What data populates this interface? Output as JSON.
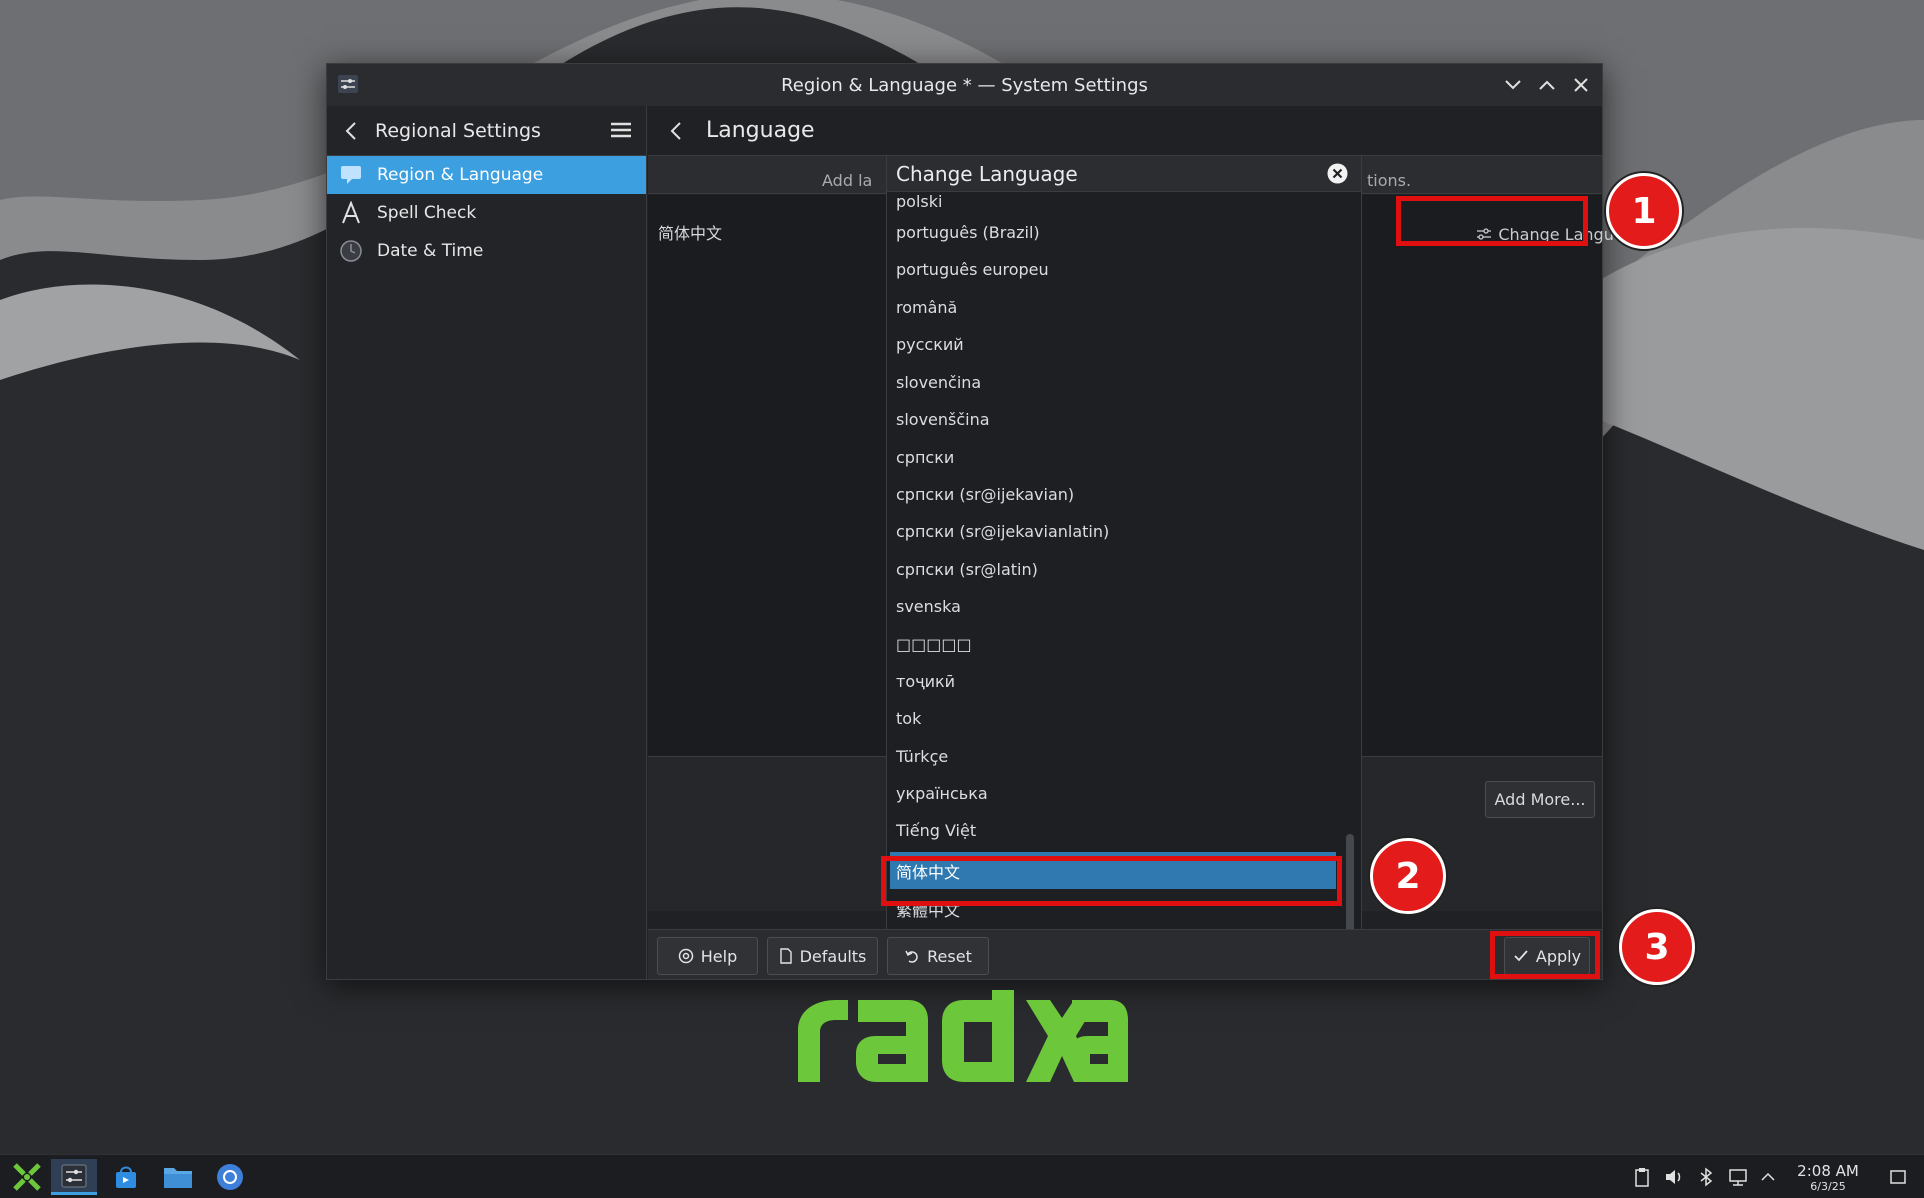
{
  "window": {
    "title": "Region & Language * — System Settings"
  },
  "sidebar": {
    "header": "Regional Settings",
    "items": [
      {
        "label": "Region & Language",
        "icon": "region-language-icon",
        "active": true
      },
      {
        "label": "Spell Check",
        "icon": "spell-check-icon",
        "active": false
      },
      {
        "label": "Date & Time",
        "icon": "clock-icon",
        "active": false
      }
    ]
  },
  "main": {
    "header": "Language",
    "info_left": "Add la",
    "info_right": "tions.",
    "current_language": "简体中文",
    "change_language_label": "Change Language",
    "add_more_label": "Add More..."
  },
  "footer": {
    "help_label": "Help",
    "defaults_label": "Defaults",
    "reset_label": "Reset",
    "apply_label": "Apply"
  },
  "popup": {
    "title": "Change Language",
    "options": [
      "polski",
      "português (Brazil)",
      "português europeu",
      "română",
      "русский",
      "slovenčina",
      "slovenščina",
      "српски",
      "српски (sr@ijekavian)",
      "српски (sr@ijekavianlatin)",
      "српски (sr@latin)",
      "svenska",
      "□□□□□",
      "тоҷикӣ",
      "tok",
      "Türkçe",
      "українська",
      "Tiếng Việt",
      "简体中文",
      "繁體中文"
    ],
    "selected": "简体中文"
  },
  "annotations": {
    "badge_1": "1",
    "badge_2": "2",
    "badge_3": "3",
    "color": "#e01010"
  },
  "taskbar": {
    "time": "2:08 AM",
    "date": "6/3/25"
  },
  "colors": {
    "accent": "#3b9fe0",
    "selected": "#2f79b0",
    "logo_green": "#6cc83a"
  }
}
